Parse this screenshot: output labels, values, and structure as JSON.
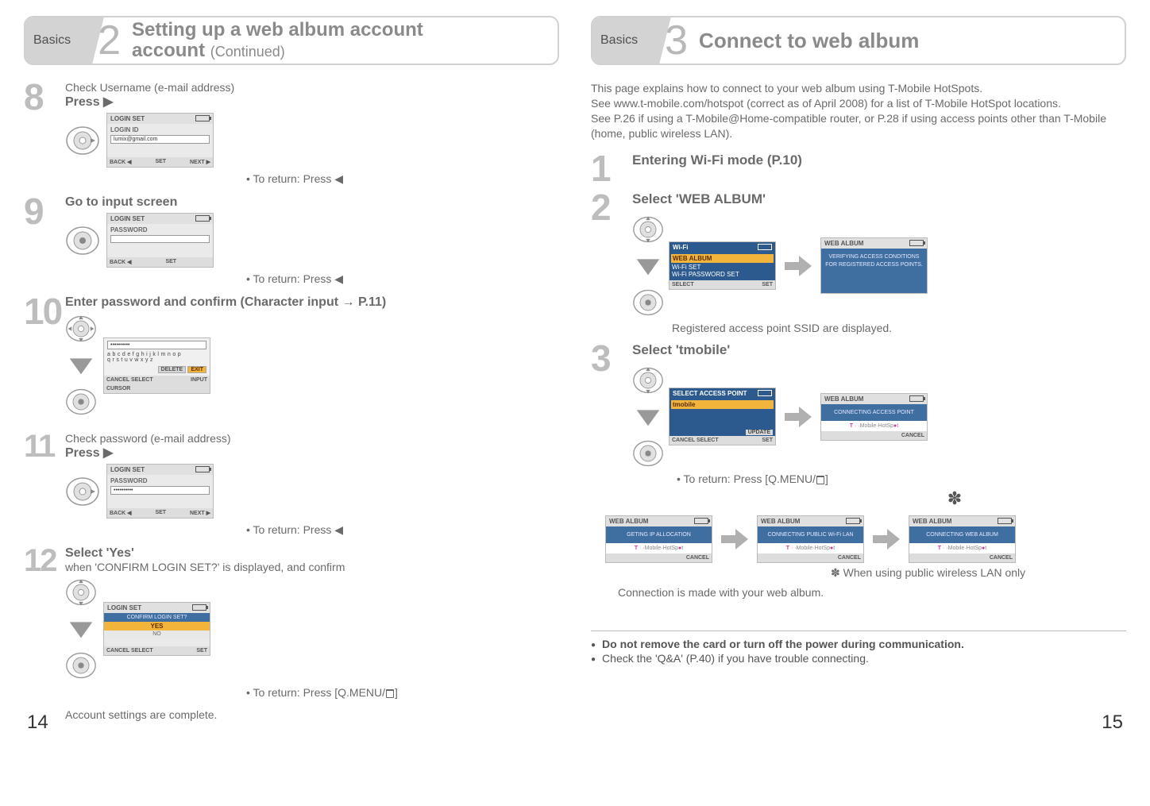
{
  "leftHeader": {
    "basics": "Basics",
    "num": "2",
    "title": "Setting up a web album account",
    "cont": "(Continued)"
  },
  "rightHeader": {
    "basics": "Basics",
    "num": "3",
    "title": "Connect to web album"
  },
  "intro": {
    "l1": "This page explains how to connect to your web album using T-Mobile HotSpots.",
    "l2": "See www.t-mobile.com/hotspot (correct as of April 2008) for a list of T-Mobile HotSpot locations.",
    "l3": "See P.26 if using a T-Mobile@Home-compatible router, or P.28 if using access points other than T-Mobile (home, public wireless LAN)."
  },
  "step8": {
    "num": "8",
    "desc": "Check Username (e-mail address)",
    "title": "Press ▶",
    "screen": {
      "hd": "LOGIN SET",
      "lbl": "LOGIN ID",
      "val": "lumix@gmail.com",
      "back": "BACK ◀",
      "set": "SET",
      "next": "NEXT ▶"
    },
    "bullet": "• To return: Press ◀"
  },
  "step9": {
    "num": "9",
    "title": "Go to input screen",
    "screen": {
      "hd": "LOGIN SET",
      "lbl": "PASSWORD",
      "back": "BACK ◀",
      "set": "SET"
    },
    "bullet": "• To return: Press ◀"
  },
  "step10": {
    "num": "10",
    "title": "Enter password and confirm (Character input → P.11)",
    "screen": {
      "dots": "••••••••••",
      "row1": "a b c d e f g h i j k l m n o p",
      "row2": "q r s t u v w x y z",
      "del": "DELETE",
      "exit": "EXIT",
      "cancel": "CANCEL",
      "sel": "SELECT",
      "cur": "CURSOR",
      "inp": "INPUT"
    }
  },
  "step11": {
    "num": "11",
    "desc": "Check password (e-mail address)",
    "title": "Press ▶",
    "screen": {
      "hd": "LOGIN SET",
      "lbl": "PASSWORD",
      "dots": "••••••••••",
      "back": "BACK ◀",
      "set": "SET",
      "next": "NEXT ▶"
    },
    "bullet": "• To return: Press ◀"
  },
  "step12": {
    "num": "12",
    "title": "Select 'Yes'",
    "sub": "when 'CONFIRM LOGIN SET?' is displayed, and confirm",
    "screen": {
      "hd": "LOGIN SET",
      "q": "CONFIRM LOGIN SET?",
      "yes": "YES",
      "no": "NO",
      "cancel": "CANCEL",
      "sel": "SELECT",
      "set": "SET"
    },
    "bullet": "• To return: Press [Q.MENU/",
    "bullet2": "]",
    "after": "Account settings are complete."
  },
  "r1": {
    "num": "1",
    "title": "Entering Wi-Fi mode (P.10)"
  },
  "r2": {
    "num": "2",
    "title": "Select 'WEB ALBUM'",
    "scrA": {
      "hd": "Wi-Fi",
      "i1": "WEB ALBUM",
      "i2": "Wi-Fi SET",
      "i3": "Wi-Fi PASSWORD SET",
      "sel": "SELECT",
      "set": "SET"
    },
    "scrB": {
      "hd": "WEB ALBUM",
      "msg": "VERIFYING ACCESS CONDITIONS FOR REGISTERED ACCESS POINTS."
    },
    "caption": "Registered access point SSID are displayed."
  },
  "r3": {
    "num": "3",
    "title": "Select 'tmobile'",
    "scrA": {
      "hd": "SELECT ACCESS POINT",
      "item": "tmobile",
      "upd": "UPDATE",
      "cancel": "CANCEL",
      "sel": "SELECT",
      "set": "SET"
    },
    "scrB": {
      "hd": "WEB ALBUM",
      "msg": "CONNECTING ACCESS POINT",
      "hot": "T··Mobile·HotSpot",
      "cancel": "CANCEL"
    },
    "bullet": "• To return: Press [Q.MENU/",
    "bullet2": "]",
    "scrC": {
      "hd": "WEB ALBUM",
      "msg": "GETING IP ALLOCATION",
      "hot": "T··Mobile·HotSpot",
      "cancel": "CANCEL"
    },
    "scrD": {
      "hd": "WEB ALBUM",
      "msg": "CONNECTING PUBLIC Wi-Fi LAN",
      "hot": "T··Mobile·HotSpot",
      "cancel": "CANCEL"
    },
    "scrE": {
      "hd": "WEB ALBUM",
      "msg": "CONNECTING WEB ALBUM",
      "hot": "T··Mobile·HotSpot",
      "cancel": "CANCEL"
    },
    "star": "✽",
    "starNote": "✽ When using public wireless LAN only",
    "conn": "Connection is made with your web album."
  },
  "warn": {
    "w1": "Do not remove the card or turn off the power during communication.",
    "w2": "Check the 'Q&A' (P.40) if you have trouble connecting."
  },
  "pg": {
    "left": "14",
    "right": "15"
  }
}
